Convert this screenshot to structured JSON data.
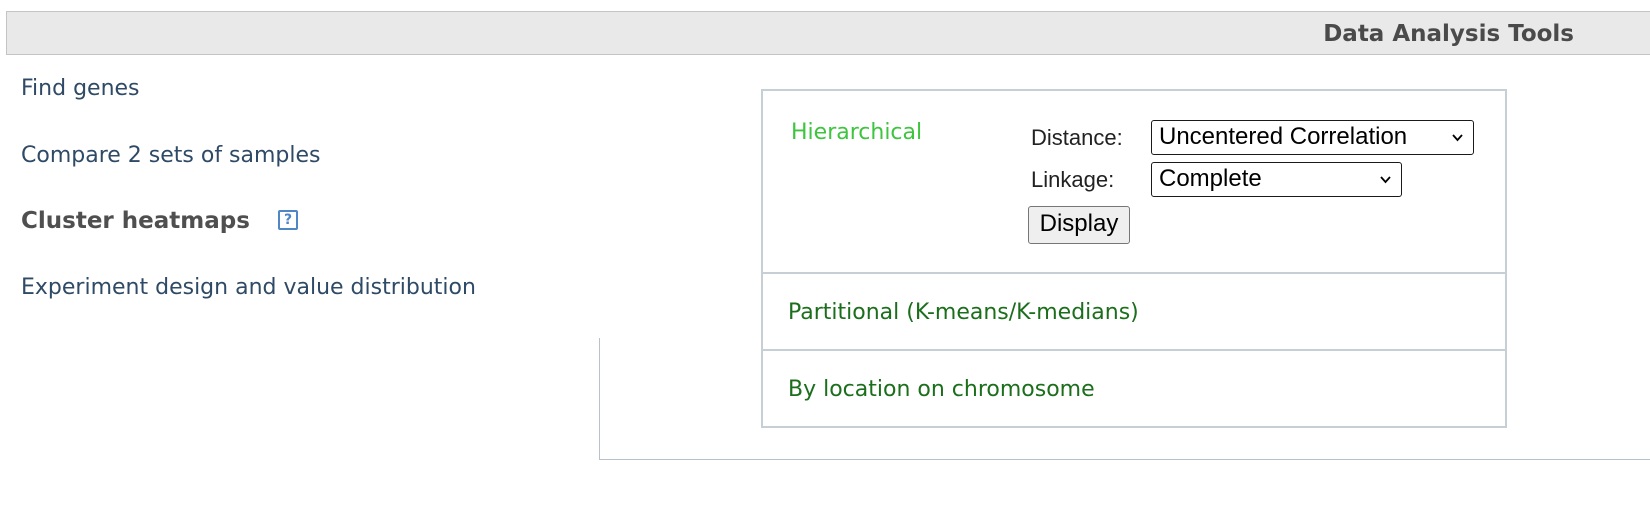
{
  "header": {
    "title": "Data Analysis Tools"
  },
  "nav": {
    "find_genes": "Find genes",
    "compare_samples": "Compare 2 sets of samples",
    "cluster_heatmaps": "Cluster heatmaps",
    "experiment_design": "Experiment design and value distribution",
    "help_glyph": "?"
  },
  "cluster": {
    "hierarchical": {
      "label": "Hierarchical",
      "distance_label": "Distance:",
      "distance_value": "Uncentered Correlation",
      "linkage_label": "Linkage:",
      "linkage_value": "Complete",
      "display_button": "Display"
    },
    "partitional": {
      "label": "Partitional (K-means/K-medians)"
    },
    "location": {
      "label": "By location on chromosome"
    }
  },
  "colors": {
    "active_method": "#3ec43e",
    "method_link": "#1b6e1b",
    "nav_link": "#2f4a66",
    "help_icon": "#4f87c6"
  },
  "icons": {
    "help": "help-icon",
    "dropdown": "chevron-down-icon"
  }
}
